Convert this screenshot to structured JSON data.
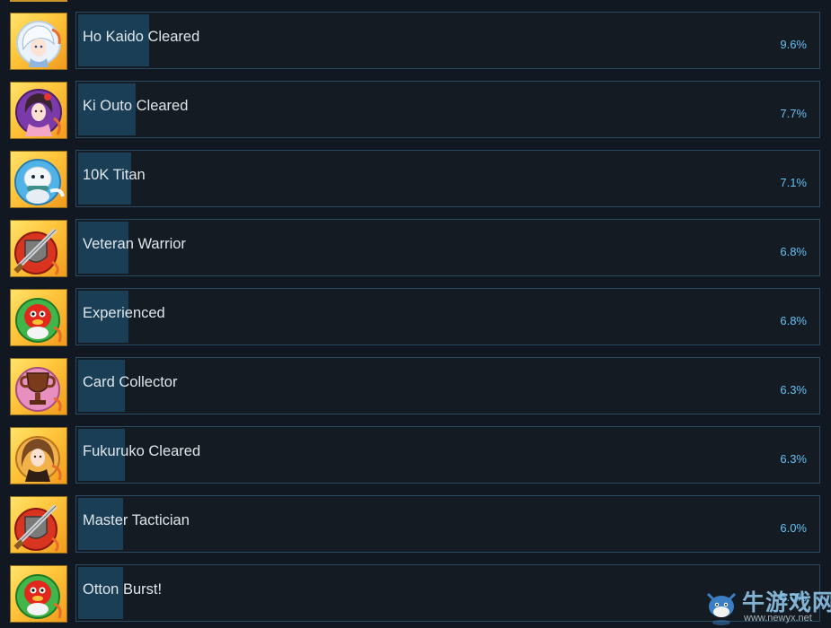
{
  "achievements": [
    {
      "name": "Ho Kaido Cleared",
      "percent_label": "9.6%",
      "percent": 9.6,
      "icon": "white-haired-girl-icon"
    },
    {
      "name": "Ki Outo Cleared",
      "percent_label": "7.7%",
      "percent": 7.7,
      "icon": "kimono-girl-icon"
    },
    {
      "name": "10K Titan",
      "percent_label": "7.1%",
      "percent": 7.1,
      "icon": "seal-creature-icon"
    },
    {
      "name": "Veteran Warrior",
      "percent_label": "6.8%",
      "percent": 6.8,
      "icon": "crossed-swords-shield-icon"
    },
    {
      "name": "Experienced",
      "percent_label": "6.8%",
      "percent": 6.8,
      "icon": "red-mascot-icon"
    },
    {
      "name": "Card Collector",
      "percent_label": "6.3%",
      "percent": 6.3,
      "icon": "trophy-icon"
    },
    {
      "name": "Fukuruko Cleared",
      "percent_label": "6.3%",
      "percent": 6.3,
      "icon": "brown-haired-girl-icon"
    },
    {
      "name": "Master Tactician",
      "percent_label": "6.0%",
      "percent": 6.0,
      "icon": "crossed-swords-shield-icon"
    },
    {
      "name": "Otton Burst!",
      "percent_label": "6.0%",
      "percent": 6.0,
      "icon": "red-mascot-icon"
    }
  ],
  "watermark": {
    "site_name": "牛游戏网",
    "url": "www.newyx.net"
  },
  "colors": {
    "background": "#121821",
    "bar_border": "#2a4a63",
    "bar_fill": "#1b3e57",
    "name_text": "#dfe6ea",
    "percent_text": "#66c0f4",
    "icon_gold": "#ffc43a"
  }
}
